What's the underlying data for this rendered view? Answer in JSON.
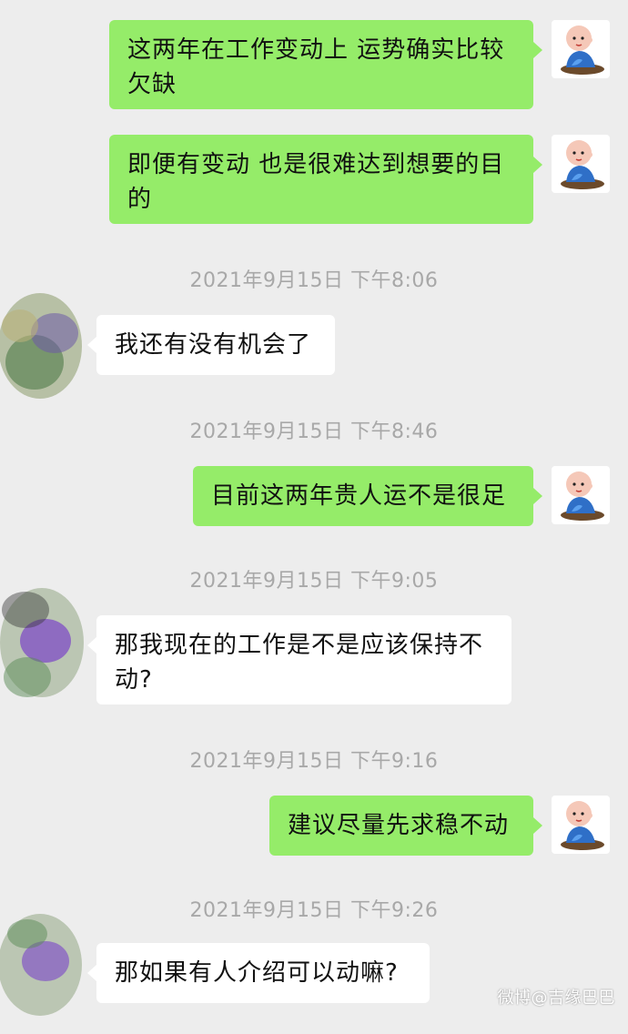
{
  "chat": {
    "messages": [
      {
        "type": "out",
        "text": "这两年在工作变动上 运势确实比较欠缺"
      },
      {
        "type": "out",
        "text": "即便有变动 也是很难达到想要的目的"
      },
      {
        "type": "time",
        "text": "2021年9月15日 下午8:06"
      },
      {
        "type": "in",
        "text": "我还有没有机会了"
      },
      {
        "type": "time",
        "text": "2021年9月15日 下午8:46"
      },
      {
        "type": "out",
        "text": "目前这两年贵人运不是很足"
      },
      {
        "type": "time",
        "text": "2021年9月15日 下午9:05"
      },
      {
        "type": "in",
        "text": "那我现在的工作是不是应该保持不动?"
      },
      {
        "type": "time",
        "text": "2021年9月15日 下午9:16"
      },
      {
        "type": "out",
        "text": "建议尽量先求稳不动"
      },
      {
        "type": "time",
        "text": "2021年9月15日 下午9:26"
      },
      {
        "type": "in",
        "text": "那如果有人介绍可以动嘛?"
      }
    ]
  },
  "watermark": "微博@吉缘巴巴",
  "colors": {
    "background": "#ededed",
    "outgoing_bubble": "#95ec69",
    "incoming_bubble": "#ffffff",
    "timestamp_text": "#a8a8a8"
  },
  "icons": {
    "my_avatar": "monk-doll-avatar-icon",
    "other_avatar": "blurred-avatar-icon"
  }
}
